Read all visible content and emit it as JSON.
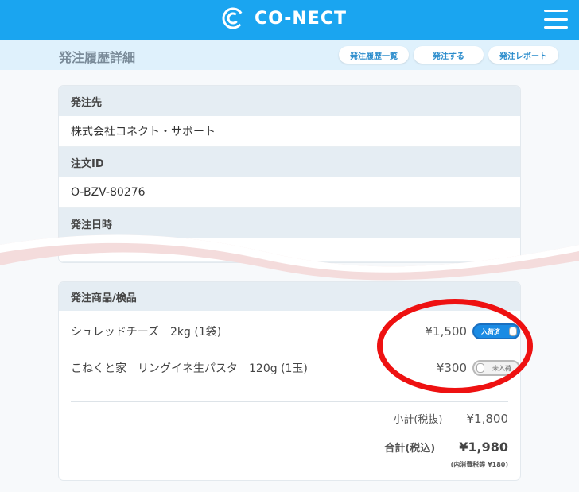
{
  "header": {
    "logo_text": "CO-NECT",
    "logo_icon": "conect-logo-icon",
    "menu_icon": "hamburger-menu-icon",
    "brand_color": "#1aa5f0"
  },
  "subheader": {
    "title": "発注履歴詳細",
    "buttons": [
      "発注履歴一覧",
      "発注する",
      "発注レポート"
    ]
  },
  "order_info": {
    "supplier_label": "発注先",
    "supplier_value": "株式会社コネクト・サポート",
    "order_id_label": "注文ID",
    "order_id_value": "O-BZV-80276",
    "order_date_label": "発注日時"
  },
  "items_section": {
    "title": "発注商品/検品",
    "items": [
      {
        "name": "シュレッドチーズ　2kg (1袋)",
        "price": "¥1,500",
        "status": "入荷済",
        "received": true
      },
      {
        "name": "こねくと家　リングイネ生パスタ　120g (1玉)",
        "price": "¥300",
        "status": "未入荷",
        "received": false
      }
    ],
    "subtotal_label": "小計(税抜)",
    "subtotal_value": "¥1,800",
    "total_label": "合計(税込)",
    "total_value": "¥1,980",
    "tax_note": "(内消費税等 ¥180)"
  },
  "annotation_color": "#ee1111"
}
